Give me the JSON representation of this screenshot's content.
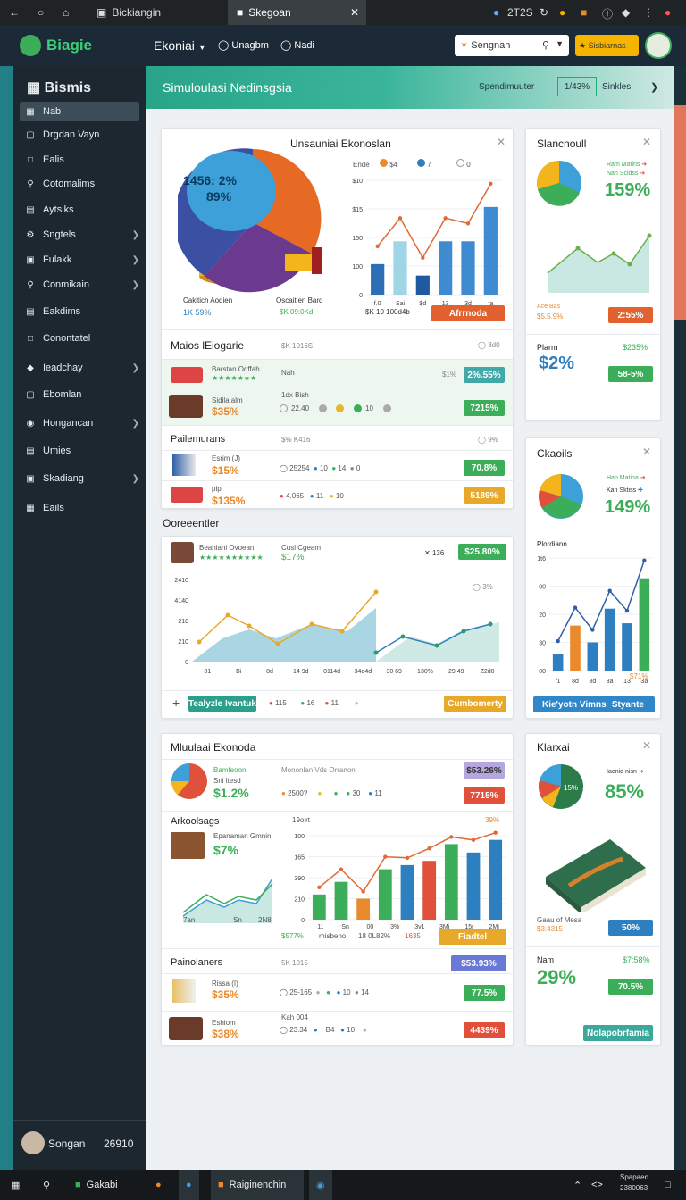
{
  "browser": {
    "tab1": "Bickiangin",
    "tab2": "Skegoan",
    "clock": "2T2S"
  },
  "topnav": {
    "logo": "Biagie",
    "menu": "Ekoniai",
    "link1": "Unagbm",
    "link2": "Nadi",
    "search": "Sengnan",
    "button": "Sisbiarnas"
  },
  "sidebar": {
    "title": "Bismis",
    "items": [
      "Nab",
      "Drgdan Vayn",
      "Ealis",
      "Cotomalims",
      "Aytsiks",
      "Sngtels",
      "Fulakk",
      "Conmikain",
      "Eakdims",
      "Conontatel",
      "Ieadchay",
      "Ebomlan",
      "Hongancan",
      "Umies",
      "Skadiang",
      "Eails"
    ],
    "user": "Songan",
    "user_value": "26910"
  },
  "banner": {
    "title": "Simuloulasi Nedinsgsia",
    "link": "Spendimuuter",
    "value": "1/43%",
    "action": "Sinkles"
  },
  "card1": {
    "title": "Unsauniai Ekonoslan",
    "pie_label": "1456: 2%",
    "pie_pct": "89%",
    "cap1": "Cakitich Aodien",
    "cap1v": "1K 59%",
    "cap2": "Oscaitien Bard",
    "cap2v": "$K 09:0Kd",
    "legend0": "Ende",
    "legend1": "$4",
    "legend2": "7",
    "legend3": "0",
    "yticks": [
      "$10",
      "$15",
      "150",
      "100",
      "0"
    ],
    "xticks": [
      "f.0",
      "Sai",
      "$d",
      "13",
      "3d",
      "fa"
    ],
    "axis_l": "$K 10 100d4b",
    "btn": "Afrrnoda",
    "section": "Maios lEiogarie",
    "section_meta": "$K 1016S",
    "section_right": "3d0",
    "r1_name": "Barstan Odffah",
    "r1_col": "Nah",
    "r1_mid": "$1%",
    "r1_pill": "2%.55%",
    "r2_name": "Sidila alm",
    "r2_val": "$35%",
    "r2_col": "1dx Bish",
    "r2_n1": "22.40",
    "r2_n2": "10",
    "r2_pill": "7215%",
    "sub": "Pailemurans",
    "sub_meta": "$% K416",
    "sub_right": "9%",
    "r3_name": "Esrim (J)",
    "r3_val": "$15%",
    "r3_n0": "25254",
    "r3_n1": "10",
    "r3_n2": "14",
    "r3_n3": "0",
    "r3_pill": "70.8%",
    "r4_name": "pipi",
    "r4_val": "$135%",
    "r4_n0": "4.065",
    "r4_n1": "11",
    "r4_n2": "10",
    "r4_pill": "5189%"
  },
  "card2": {
    "title": "Slancnoull",
    "l1": "Ram Matins",
    "l2": "Nan Scidss",
    "big": "159%",
    "sub": "Ace Bas",
    "subv": "$5.5.9%",
    "pill": "2:55%",
    "label": "Plarm",
    "labelv": "$235%",
    "big2": "$2%",
    "pill2": "58-5%"
  },
  "card3": {
    "title": "Ckaoils",
    "l1": "Han Matina",
    "l2": "Kan Sktiss",
    "big": "149%",
    "label": "Plordiann",
    "yticks": [
      "1t6",
      "00",
      "20",
      "30",
      "00"
    ],
    "xticks": [
      "f1",
      "8d",
      "3d",
      "3a",
      "13",
      "3a"
    ],
    "val": "$71%",
    "btn_l": "Kie'yotn Vimns",
    "btn_r": "Styante"
  },
  "card4": {
    "title": "Ooreeentler",
    "item": "Beahiani Ovoean",
    "item_v": "$17%",
    "col": "Cusl Cgeam",
    "n": "136",
    "pill": "$25.80%",
    "right": "3%",
    "yticks": [
      "2410",
      "4140",
      "210",
      "210",
      "0"
    ],
    "xticks": [
      "01",
      "Bi",
      "8d",
      "14 9d",
      "0114d",
      "34d4d",
      "30 69",
      "130%",
      "29 49",
      "Z2d0"
    ],
    "btn": "Tealyzle Ivantuk",
    "d1": "115",
    "d2": "16",
    "d3": "11",
    "btn2": "Cumbomerty"
  },
  "card5": {
    "title": "Mluulaai Ekonoda",
    "name": "Bamfeoon",
    "sub": "Sni ltesd",
    "val": "$1.2%",
    "col": "Mononlan Vds Orranon",
    "coln": "$53.26%",
    "n0": "2500?",
    "n1": "30",
    "n2": "11",
    "pill": "7715%",
    "sec": "Arkoolsags",
    "sec_name": "Epanaman Gmnin",
    "sec_val": "$7%",
    "sec_r1": "19oirt",
    "sec_r2": "39%",
    "xt": [
      "7an",
      "Sn",
      "2N8"
    ],
    "yticks": [
      "100",
      "165",
      "390",
      "210",
      "0"
    ],
    "xticks": [
      "11",
      "Sn",
      "00",
      "3%",
      "3v1",
      "3Mi",
      "15r",
      "2Mi"
    ],
    "f1": "$577%",
    "f2": "misbeno",
    "f3": "18 0L82%",
    "f4": "1635",
    "btn": "Fiadtel",
    "sub2": "Painolaners",
    "sub2_meta": "5K 1015",
    "sub2_pill": "$53.93%",
    "r1_name": "Rissa (I)",
    "r1_val": "$35%",
    "r1_n0": "25-165",
    "r1_n1": "10",
    "r1_n2": "14",
    "r1_pill": "77.5%",
    "r2_name": "Eshiom",
    "r2_val": "$38%",
    "r2_col": "Kah 004",
    "r2_n0": "23.34",
    "r2_n1": "B4",
    "r2_n2": "10",
    "r2_pill": "4439%"
  },
  "card6": {
    "title": "Klarxai",
    "l1": "Iaenid nisn",
    "pie": "15%",
    "big": "85%",
    "cap": "Gaau of Mesa",
    "capv": "$3:4315",
    "pill": "50%",
    "label": "Nam",
    "labelv": "$7:58%",
    "big2": "29%",
    "pill2": "70.5%",
    "btn": "Nolapobrfamia"
  },
  "taskbar": {
    "app1": "Gakabi",
    "app2": "Raiginenchin",
    "tray1": "Spapaen",
    "tray2": "2380063"
  },
  "chart_data": [
    {
      "type": "bar",
      "title": "Unsauniai Ekonoslan",
      "categories": [
        "f.0",
        "Sai",
        "$d",
        "13",
        "3d",
        "fa"
      ],
      "values": [
        40,
        70,
        25,
        70,
        70,
        115
      ],
      "ylim": [
        0,
        150
      ]
    },
    {
      "type": "bar",
      "title": "Plordiann",
      "categories": [
        "f1",
        "8d",
        "3d",
        "3a",
        "13",
        "3a"
      ],
      "values": [
        15,
        40,
        25,
        55,
        42,
        82
      ],
      "ylim": [
        0,
        100
      ]
    },
    {
      "type": "bar",
      "title": "Arkoolsags",
      "categories": [
        "11",
        "Sn",
        "00",
        "3%",
        "3v1",
        "3Mi",
        "15r",
        "2Mi"
      ],
      "values": [
        30,
        45,
        25,
        60,
        65,
        70,
        90,
        80,
        95
      ],
      "ylim": [
        0,
        100
      ]
    }
  ]
}
